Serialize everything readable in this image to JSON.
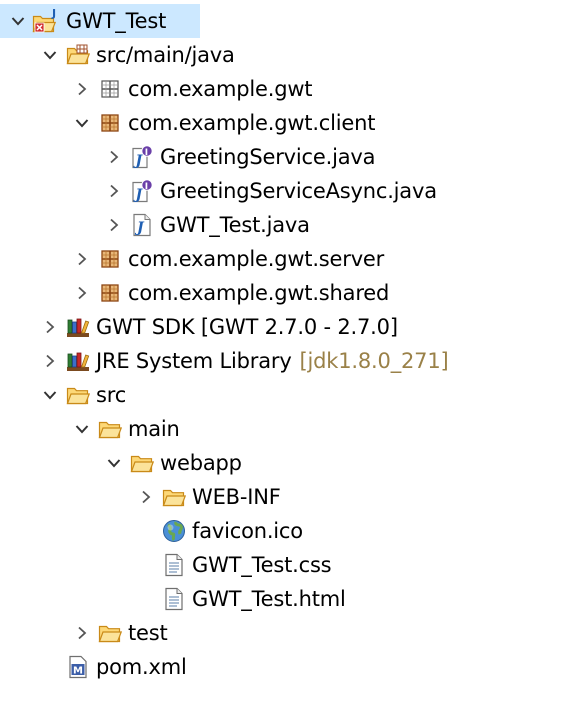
{
  "explorer": {
    "rows": [
      {
        "label": "GWT_Test",
        "icon": "gwt-project-icon",
        "expanded": true,
        "level": 0
      },
      {
        "label": "src/main/java",
        "icon": "source-folder-icon",
        "expanded": true,
        "level": 1
      },
      {
        "label": "com.example.gwt",
        "icon": "empty-package-icon",
        "expanded": false,
        "level": 2
      },
      {
        "label": "com.example.gwt.client",
        "icon": "package-icon",
        "expanded": true,
        "level": 2
      },
      {
        "label": "GreetingService.java",
        "icon": "java-interface-icon",
        "expanded": false,
        "level": 3
      },
      {
        "label": "GreetingServiceAsync.java",
        "icon": "java-interface-icon",
        "expanded": false,
        "level": 3
      },
      {
        "label": "GWT_Test.java",
        "icon": "java-file-icon",
        "expanded": false,
        "level": 3
      },
      {
        "label": "com.example.gwt.server",
        "icon": "package-icon",
        "expanded": false,
        "level": 2
      },
      {
        "label": "com.example.gwt.shared",
        "icon": "package-icon",
        "expanded": false,
        "level": 2
      },
      {
        "label": "GWT SDK [GWT 2.7.0 - 2.7.0]",
        "icon": "library-icon",
        "expanded": false,
        "level": 1
      },
      {
        "label": "JRE System Library",
        "decoration": "[jdk1.8.0_271]",
        "icon": "library-icon",
        "expanded": false,
        "level": 1
      },
      {
        "label": "src",
        "icon": "folder-open-icon",
        "expanded": true,
        "level": 1
      },
      {
        "label": "main",
        "icon": "folder-open-icon",
        "expanded": true,
        "level": 2
      },
      {
        "label": "webapp",
        "icon": "folder-open-icon",
        "expanded": true,
        "level": 3
      },
      {
        "label": "WEB-INF",
        "icon": "folder-open-icon",
        "expanded": false,
        "level": 4
      },
      {
        "label": "favicon.ico",
        "icon": "globe-icon",
        "level": 4
      },
      {
        "label": "GWT_Test.css",
        "icon": "text-file-icon",
        "level": 4
      },
      {
        "label": "GWT_Test.html",
        "icon": "text-file-icon",
        "level": 4
      },
      {
        "label": "test",
        "icon": "folder-open-icon",
        "expanded": false,
        "level": 2
      },
      {
        "label": "pom.xml",
        "icon": "maven-pom-icon",
        "level": 1
      }
    ]
  },
  "colors": {
    "selection": "#cce8ff",
    "decoration": "#9a8148",
    "folder": "#e8a83a",
    "package": "#b5651d",
    "java": "#1f5fb3",
    "interface_badge": "#6a3fa8"
  }
}
